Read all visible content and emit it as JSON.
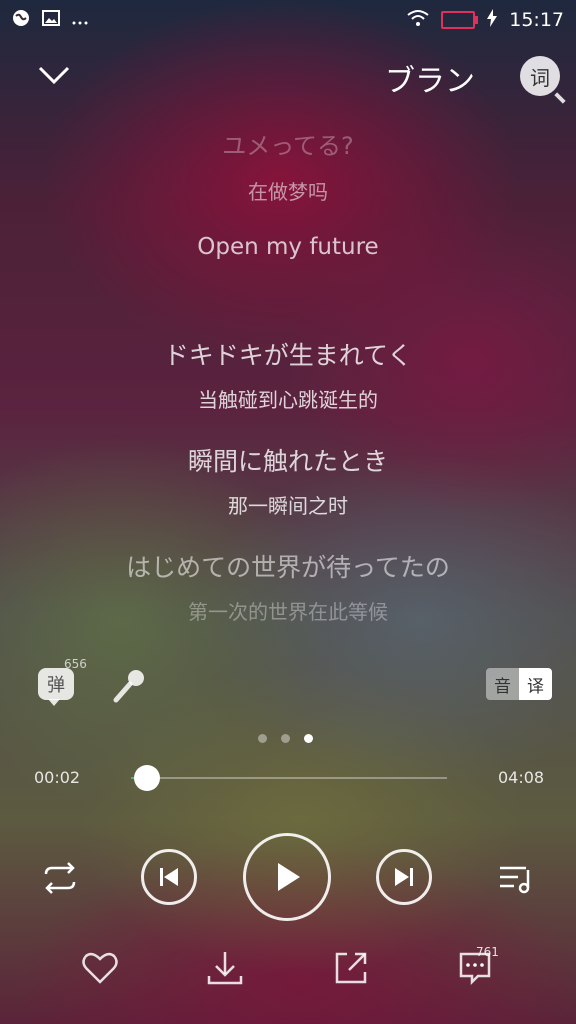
{
  "status_bar": {
    "time": "15:17",
    "left_icons": [
      "browser-icon",
      "gallery-icon",
      "more-dots-icon"
    ],
    "right_icons": [
      "wifi-icon",
      "battery-icon",
      "charging-icon"
    ]
  },
  "header": {
    "song_title": "ブランコ",
    "lyric_button": "词"
  },
  "lyrics": {
    "line1_jp": "ユメってる?",
    "line1_cn": "在做梦吗",
    "line2_en": "Open my future",
    "line3_jp": "ドキドキが生まれてく",
    "line3_cn": "当触碰到心跳诞生的",
    "line4_jp": "瞬間に触れたとき",
    "line4_cn": "那一瞬间之时",
    "line5_jp": "はじめての世界が待ってたの",
    "line5_cn": "第一次的世界在此等候"
  },
  "tools": {
    "danmu_label": "弹",
    "danmu_count": "656",
    "toggle_sound": "音",
    "toggle_translate": "译"
  },
  "pager": {
    "count": 3,
    "active": 3
  },
  "progress": {
    "current": "00:02",
    "total": "04:08",
    "fraction": 0.008
  },
  "bottom": {
    "comment_count": "761"
  },
  "colors": {
    "progress_accent": "#3fbf6a",
    "battery": "#e0305c"
  }
}
